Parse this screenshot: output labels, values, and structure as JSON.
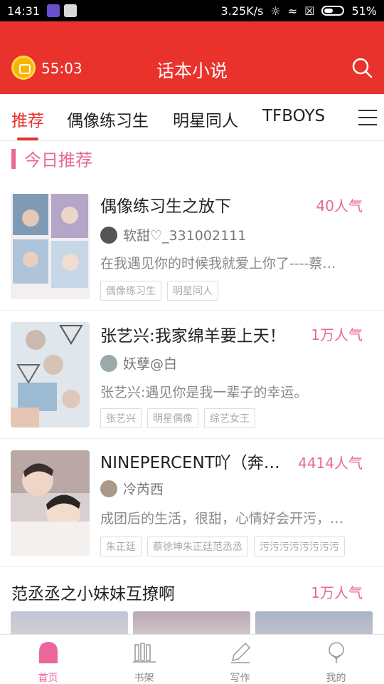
{
  "status_bar": {
    "time": "14:31",
    "speed": "3.25K/s",
    "battery": "51%",
    "battery_level": 0.51
  },
  "header": {
    "timer": "55:03",
    "title": "话本小说"
  },
  "tabs": [
    {
      "label": "推荐"
    },
    {
      "label": "偶像练习生"
    },
    {
      "label": "明星同人"
    },
    {
      "label": "TFBOYS"
    }
  ],
  "section": {
    "title": "今日推荐"
  },
  "books": [
    {
      "title": "偶像练习生之放下",
      "popularity": "40人气",
      "author": "软甜♡_331002111",
      "desc": "在我遇见你的时候我就爱上你了----蔡…",
      "tags": [
        "偶像练习生",
        "明星同人"
      ],
      "cover_color": "#b9c7d6",
      "avatar_color": "#555"
    },
    {
      "title": "张艺兴:我家绵羊要上天！",
      "popularity": "1万人气",
      "author": "妖孽@白",
      "desc": "张艺兴:遇见你是我一辈子的幸运。",
      "tags": [
        "张艺兴",
        "明星偶像",
        "综艺女王"
      ],
      "cover_color": "#9fb6c9",
      "avatar_color": "#9aa"
    },
    {
      "title": "NINEPERCENT吖（奔…",
      "popularity": "4414人气",
      "author": "冷芮西",
      "desc": "成团后的生活，很甜，心情好会开污，…",
      "tags": [
        "朱正廷",
        "蔡徐坤朱正廷范丞丞",
        "污污污污污污污污"
      ],
      "cover_color": "#c9b6b0",
      "avatar_color": "#a98"
    }
  ],
  "featured": {
    "title": "范丞丞之小妹妹互撩啊",
    "popularity": "1万人气"
  },
  "bottom_nav": [
    {
      "label": "首页",
      "icon": "home-icon"
    },
    {
      "label": "书架",
      "icon": "bookshelf-icon"
    },
    {
      "label": "写作",
      "icon": "write-icon"
    },
    {
      "label": "我的",
      "icon": "profile-icon"
    }
  ],
  "colors": {
    "accent": "#e8322b",
    "pink": "#e9679a"
  }
}
